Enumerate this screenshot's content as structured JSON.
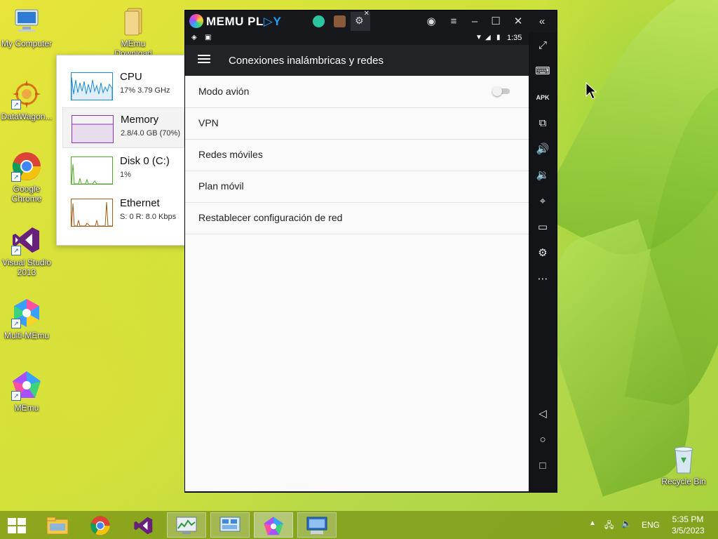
{
  "desktop": {
    "icons": [
      {
        "label": "My Computer"
      },
      {
        "label": "MEmu Download"
      },
      {
        "label": "DataWagon..."
      },
      {
        "label": "Google Chrome"
      },
      {
        "label": "Visual Studio 2013"
      },
      {
        "label": "Multi-MEmu"
      },
      {
        "label": "MEmu"
      },
      {
        "label": "Recycle Bin"
      }
    ]
  },
  "task_manager": {
    "items": [
      {
        "name": "CPU",
        "value": "17% 3.79 GHz",
        "color": "#1b8ad1"
      },
      {
        "name": "Memory",
        "value": "2.8/4.0 GB (70%)",
        "color": "#8b36b8"
      },
      {
        "name": "Disk 0 (C:)",
        "value": "1%",
        "color": "#4caa22"
      },
      {
        "name": "Ethernet",
        "value": "S: 0 R: 8.0 Kbps",
        "color": "#a45a12"
      }
    ]
  },
  "memu": {
    "logo_main": "MEMU PL",
    "logo_accent": "▷Y",
    "status_time": "1:35",
    "app_title": "Conexiones inalámbricas y redes",
    "settings": [
      {
        "label": "Modo avión",
        "toggle": "off"
      },
      {
        "label": "VPN"
      },
      {
        "label": "Redes móviles"
      },
      {
        "label": "Plan móvil"
      },
      {
        "label": "Restablecer configuración de red"
      }
    ]
  },
  "taskbar": {
    "language": "ENG",
    "time": "5:35 PM",
    "date": "3/5/2023"
  }
}
